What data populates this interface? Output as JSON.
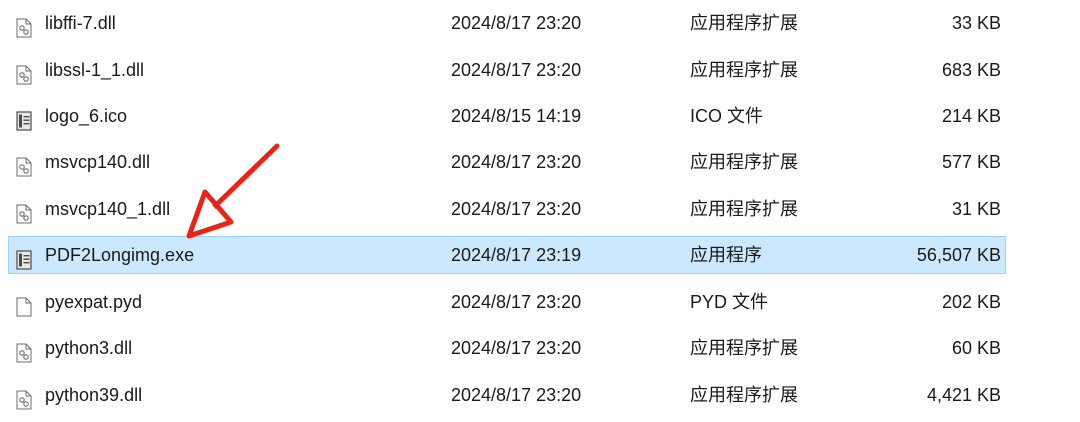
{
  "files": [
    {
      "name": "libffi-7.dll",
      "date": "2024/8/17 23:20",
      "type": "应用程序扩展",
      "size": "33 KB",
      "icon": "dll-file-icon"
    },
    {
      "name": "libssl-1_1.dll",
      "date": "2024/8/17 23:20",
      "type": "应用程序扩展",
      "size": "683 KB",
      "icon": "dll-file-icon"
    },
    {
      "name": "logo_6.ico",
      "date": "2024/8/15 14:19",
      "type": "ICO 文件",
      "size": "214 KB",
      "icon": "app-file-icon"
    },
    {
      "name": "msvcp140.dll",
      "date": "2024/8/17 23:20",
      "type": "应用程序扩展",
      "size": "577 KB",
      "icon": "dll-file-icon"
    },
    {
      "name": "msvcp140_1.dll",
      "date": "2024/8/17 23:20",
      "type": "应用程序扩展",
      "size": "31 KB",
      "icon": "dll-file-icon"
    },
    {
      "name": "PDF2Longimg.exe",
      "date": "2024/8/17 23:19",
      "type": "应用程序",
      "size": "56,507 KB",
      "icon": "app-file-icon",
      "selected": true
    },
    {
      "name": "pyexpat.pyd",
      "date": "2024/8/17 23:20",
      "type": "PYD 文件",
      "size": "202 KB",
      "icon": "blank-file-icon"
    },
    {
      "name": "python3.dll",
      "date": "2024/8/17 23:20",
      "type": "应用程序扩展",
      "size": "60 KB",
      "icon": "dll-file-icon"
    },
    {
      "name": "python39.dll",
      "date": "2024/8/17 23:20",
      "type": "应用程序扩展",
      "size": "4,421 KB",
      "icon": "dll-file-icon"
    }
  ],
  "colors": {
    "selection_bg": "#cce8ff",
    "selection_border": "#99d1ff",
    "arrow": "#e8231a",
    "text": "#1a1a1a"
  }
}
